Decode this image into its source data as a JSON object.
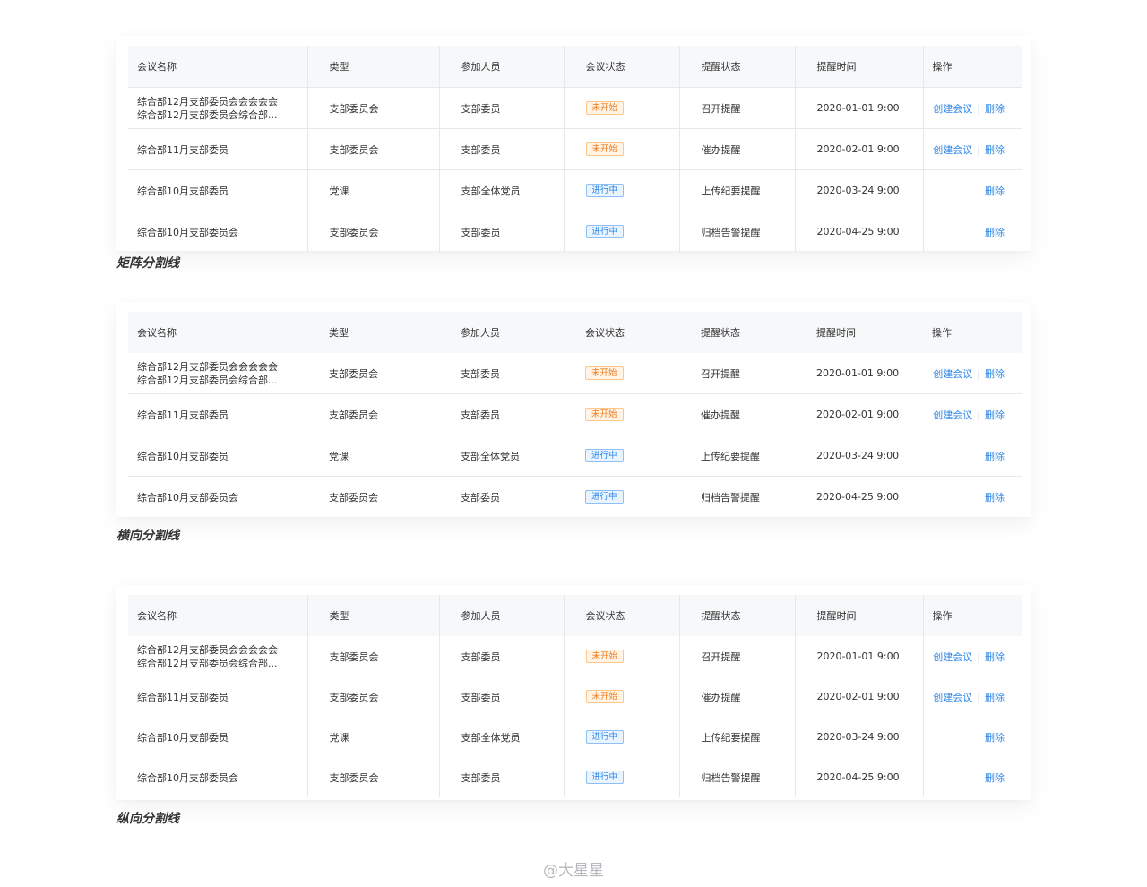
{
  "headers": {
    "name": "会议名称",
    "type": "类型",
    "participants": "参加人员",
    "meeting_status": "会议状态",
    "reminder_status": "提醒状态",
    "reminder_time": "提醒时间",
    "operation": "操作"
  },
  "rows": [
    {
      "name_line1": "综合部12月支部委员会会会会会",
      "name_line2": "综合部12月支部委员会综合部...",
      "type": "支部委员会",
      "participants": "支部委员",
      "status": "未开始",
      "reminder": "召开提醒",
      "time": "2020-01-01  9:00",
      "create_label": "创建会议",
      "delete_label": "删除"
    },
    {
      "name_line1": "综合部11月支部委员",
      "type": "支部委员会",
      "participants": "支部委员",
      "status": "未开始",
      "reminder": "催办提醒",
      "time": "2020-02-01  9:00",
      "create_label": "创建会议",
      "delete_label": "删除"
    },
    {
      "name_line1": "综合部10月支部委员",
      "type": "党课",
      "participants": "支部全体党员",
      "status": "进行中",
      "reminder": "上传纪要提醒",
      "time": "2020-03-24  9:00",
      "delete_label": "删除"
    },
    {
      "name_line1": "综合部10月支部委员会",
      "type": "支部委员会",
      "participants": "支部委员",
      "status": "进行中",
      "reminder": "归档告警提醒",
      "time": "2020-04-25  9:00",
      "delete_label": "删除"
    }
  ],
  "captions": {
    "matrix": "矩阵分割线",
    "horizontal": "横向分割线",
    "vertical": "纵向分割线"
  },
  "watermark": "@大星星",
  "colors": {
    "link": "#2e87e8",
    "pending_badge": "#f07a1b",
    "active_badge": "#2e87e8",
    "header_bg": "#f7f8fa",
    "divider": "#e6e8eb"
  }
}
